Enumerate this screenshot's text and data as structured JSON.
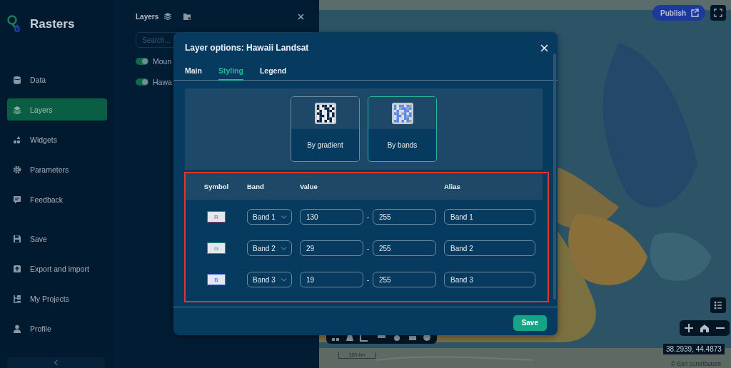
{
  "app": {
    "name": "Rasters"
  },
  "sidebar": {
    "items": [
      {
        "label": "Data",
        "selected": false
      },
      {
        "label": "Layers",
        "selected": true
      },
      {
        "label": "Widgets",
        "selected": false
      },
      {
        "label": "Parameters",
        "selected": false
      },
      {
        "label": "Feedback",
        "selected": false
      },
      {
        "label": "Save",
        "selected": false
      },
      {
        "label": "Export and import",
        "selected": false
      },
      {
        "label": "My Projects",
        "selected": false
      },
      {
        "label": "Profile",
        "selected": false
      }
    ]
  },
  "layers_panel": {
    "title": "Layers",
    "search": {
      "placeholder": "Search..."
    },
    "layers": [
      {
        "name": "Moun",
        "on": true
      },
      {
        "name": "Hawa",
        "on": true
      }
    ]
  },
  "map": {
    "publish": "Publish",
    "coordinates": "38.2939, 44.4873",
    "scale": "100 km",
    "attribution": "© Esri contributors"
  },
  "dialog": {
    "title": "Layer options: Hawaii Landsat",
    "tabs": [
      {
        "label": "Main",
        "selected": false
      },
      {
        "label": "Styling",
        "selected": true
      },
      {
        "label": "Legend",
        "selected": false
      }
    ],
    "style_options": [
      {
        "label": "By gradient",
        "selected": false
      },
      {
        "label": "By bands",
        "selected": true
      }
    ],
    "table": {
      "highlighted": true,
      "columns": [
        "Symbol",
        "Band",
        "Value",
        "Alias"
      ],
      "rows": [
        {
          "symbol": "R",
          "color": "#b0406a",
          "band": "Band 1",
          "min": "130",
          "separator": "-",
          "max": "255",
          "alias": "Band 1"
        },
        {
          "symbol": "G",
          "color": "#1e9a80",
          "band": "Band 2",
          "min": "29",
          "separator": "-",
          "max": "255",
          "alias": "Band 2"
        },
        {
          "symbol": "B",
          "color": "#3a5fe0",
          "band": "Band 3",
          "min": "19",
          "separator": "-",
          "max": "255",
          "alias": "Band 3"
        }
      ]
    },
    "save": "Save"
  }
}
